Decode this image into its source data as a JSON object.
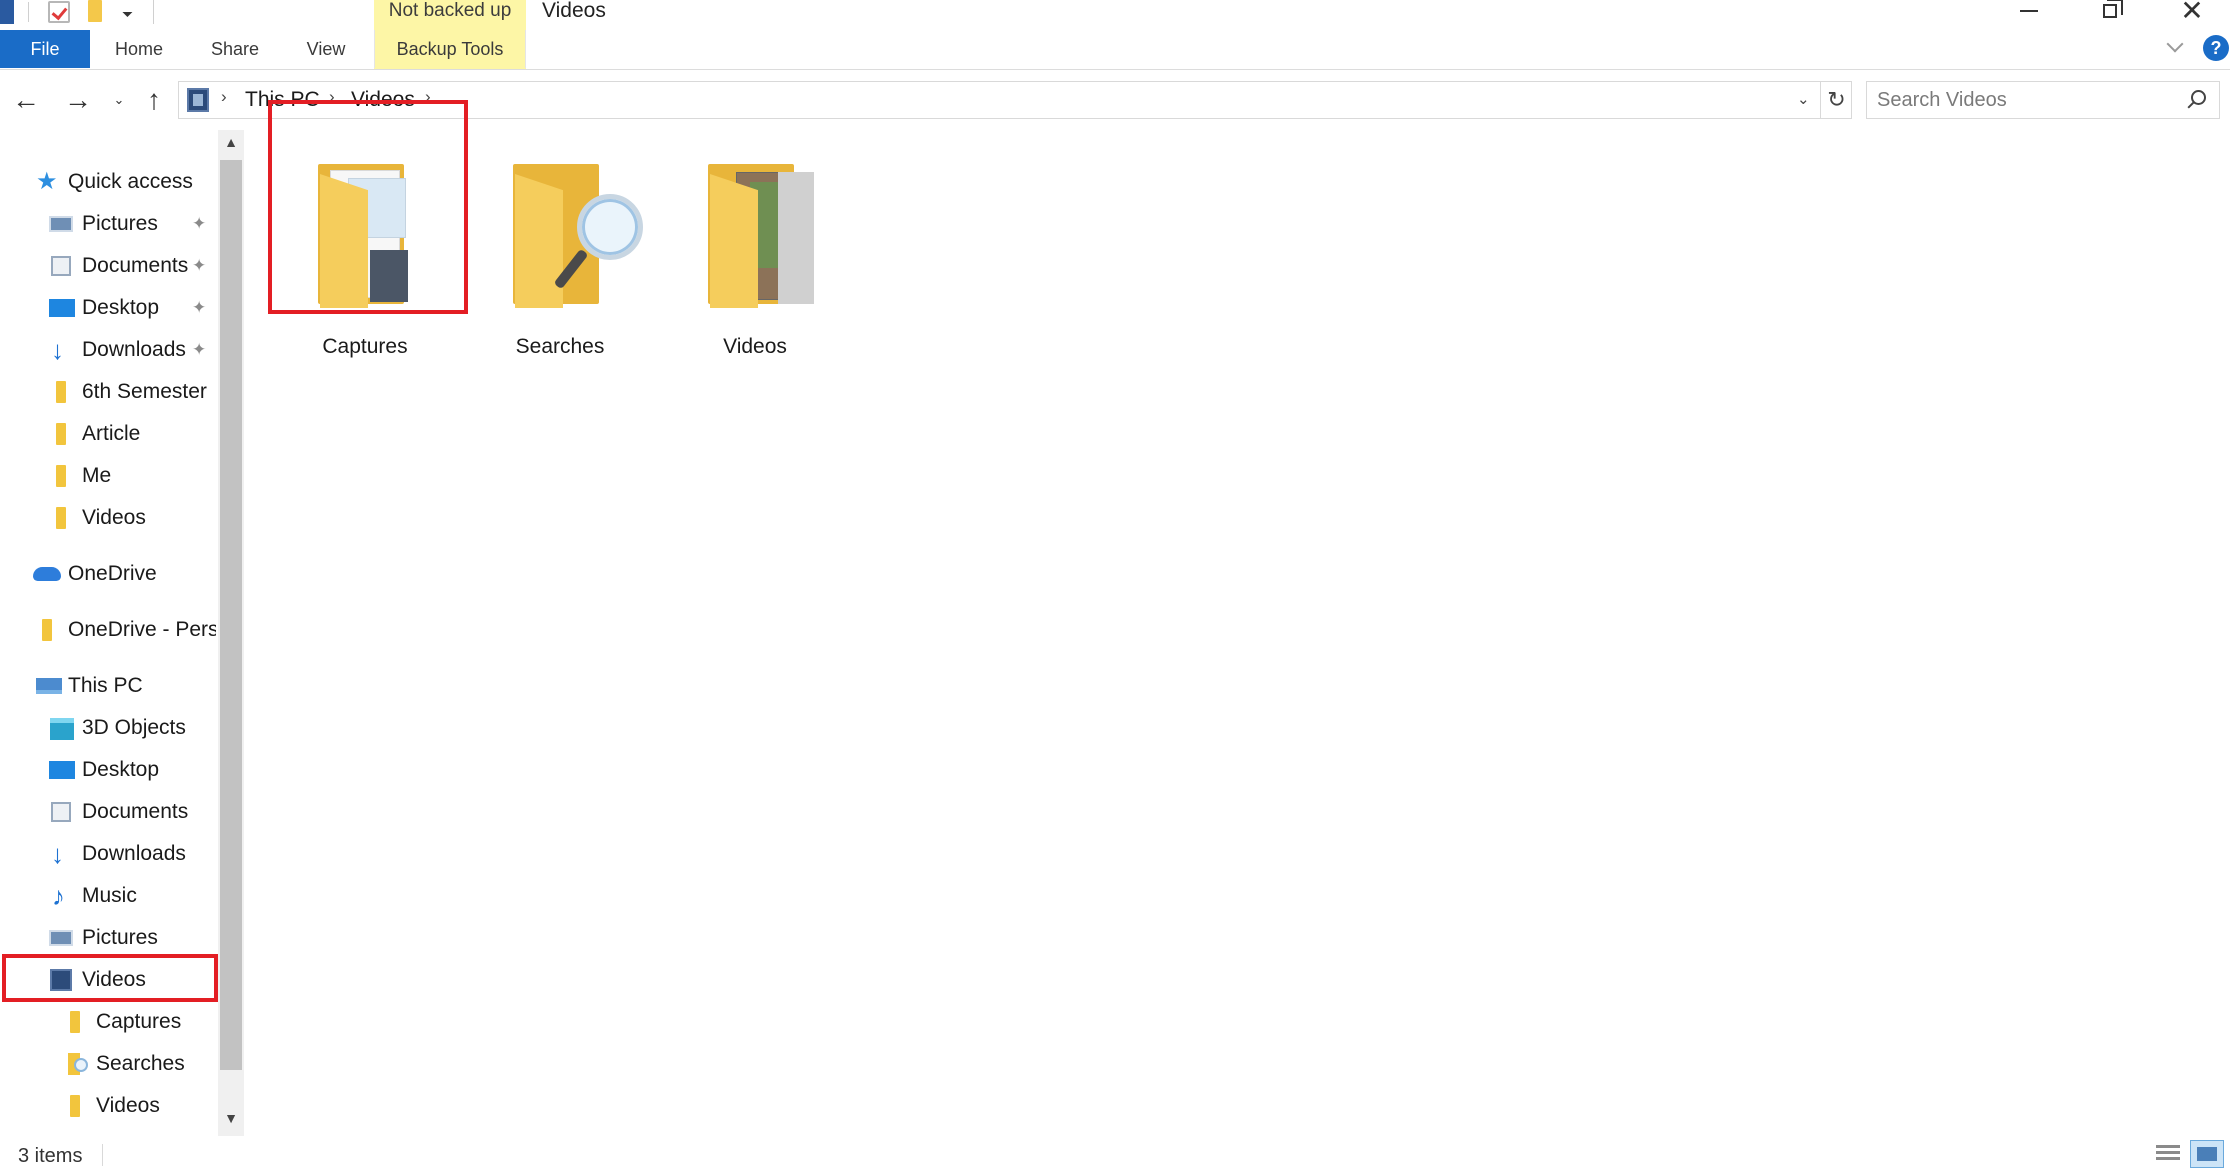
{
  "window": {
    "title": "Videos",
    "contextual_tab_group": "Not backed up",
    "controls": {
      "minimize": "minimize-icon",
      "restore": "restore-icon",
      "close": "close-icon"
    }
  },
  "quick_access_toolbar": {
    "icons": [
      "app-icon",
      "properties-icon",
      "new-folder-icon",
      "customize-dropdown-icon"
    ]
  },
  "ribbon": {
    "tabs": [
      {
        "label": "File"
      },
      {
        "label": "Home"
      },
      {
        "label": "Share"
      },
      {
        "label": "View"
      },
      {
        "label": "Backup Tools"
      }
    ],
    "file_color": "#1a6cc7",
    "help_label": "?"
  },
  "navigation": {
    "back": "←",
    "forward": "→",
    "recent": "⌄",
    "up": "↑",
    "breadcrumb": [
      {
        "label": "This PC"
      },
      {
        "label": "Videos"
      }
    ],
    "refresh": "↻",
    "search_placeholder": "Search Videos"
  },
  "nav_pane": {
    "items": [
      {
        "label": "Quick access",
        "icon": "star-icon"
      },
      {
        "label": "Pictures",
        "icon": "pictures-icon",
        "pinned": true
      },
      {
        "label": "Documents",
        "icon": "documents-icon",
        "pinned": true
      },
      {
        "label": "Desktop",
        "icon": "desktop-icon",
        "pinned": true
      },
      {
        "label": "Downloads",
        "icon": "downloads-icon",
        "pinned": true
      },
      {
        "label": "6th Semester",
        "icon": "folder-icon"
      },
      {
        "label": "Article",
        "icon": "folder-icon"
      },
      {
        "label": "Me",
        "icon": "folder-icon"
      },
      {
        "label": "Videos",
        "icon": "folder-icon"
      },
      {
        "label": "OneDrive",
        "icon": "cloud-icon"
      },
      {
        "label": "OneDrive - Pers",
        "icon": "folder-icon"
      },
      {
        "label": "This PC",
        "icon": "computer-icon"
      },
      {
        "label": "3D Objects",
        "icon": "3d-objects-icon"
      },
      {
        "label": "Desktop",
        "icon": "desktop-icon"
      },
      {
        "label": "Documents",
        "icon": "documents-icon"
      },
      {
        "label": "Downloads",
        "icon": "downloads-icon"
      },
      {
        "label": "Music",
        "icon": "music-icon"
      },
      {
        "label": "Pictures",
        "icon": "pictures-icon"
      },
      {
        "label": "Videos",
        "icon": "videos-icon",
        "selected": true
      },
      {
        "label": "Captures",
        "icon": "folder-icon"
      },
      {
        "label": "Searches",
        "icon": "search-folder-icon"
      },
      {
        "label": "Videos",
        "icon": "folder-icon"
      }
    ],
    "pin_glyph": "📌"
  },
  "content": {
    "folders": [
      {
        "label": "Captures",
        "highlighted": true
      },
      {
        "label": "Searches"
      },
      {
        "label": "Videos"
      }
    ]
  },
  "status_bar": {
    "item_count": "3 items",
    "view_buttons": [
      "details-view-icon",
      "large-icons-view-icon"
    ]
  },
  "colors": {
    "highlight_box": "#e31e24",
    "contextual_tab_bg": "#fdf6a6",
    "accent": "#1a6cc7"
  }
}
